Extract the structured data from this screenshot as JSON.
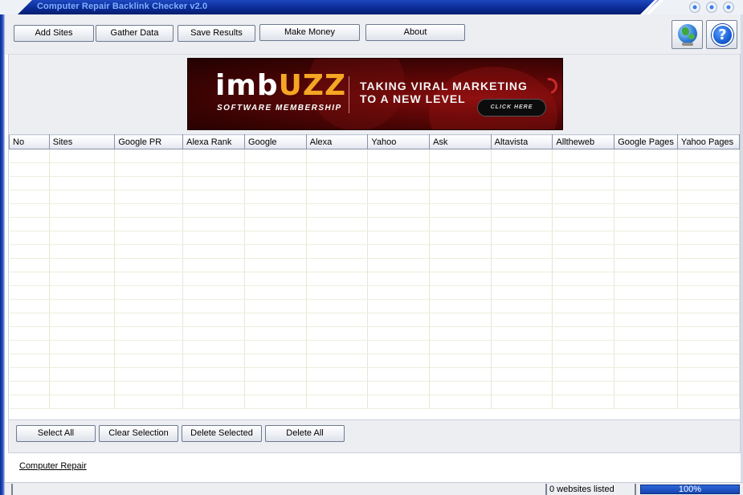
{
  "window": {
    "title": "Computer Repair Backlink Checker v2.0"
  },
  "toolbar": {
    "buttons": [
      {
        "label": "Add Sites"
      },
      {
        "label": "Gather Data"
      },
      {
        "label": "Save Results"
      },
      {
        "label": "Make Money"
      },
      {
        "label": "About"
      }
    ],
    "globe_icon": "globe-icon",
    "help_icon": "help-icon",
    "help_glyph": "?"
  },
  "banner": {
    "logo_part1": "imb",
    "logo_part2": "UZZ",
    "subtitle": "SOFTWARE MEMBERSHIP",
    "tagline1": "TAKING VIRAL MARKETING",
    "tagline2": "TO A NEW LEVEL",
    "cta": "CLICK HERE"
  },
  "table": {
    "columns": [
      "No",
      "Sites",
      "Google PR",
      "Alexa Rank",
      "Google",
      "Alexa",
      "Yahoo",
      "Ask",
      "Altavista",
      "Alltheweb",
      "Google Pages",
      "Yahoo Pages"
    ],
    "rows": []
  },
  "actions": {
    "buttons": [
      {
        "label": "Select All"
      },
      {
        "label": "Clear Selection"
      },
      {
        "label": "Delete Selected"
      },
      {
        "label": "Delete All"
      }
    ]
  },
  "footer": {
    "link": "Computer Repair"
  },
  "status": {
    "websites_listed": "0 websites listed",
    "progress_text": "100%",
    "progress_value": 100
  },
  "colors": {
    "title_bar": "#0b2b96",
    "title_text": "#7fb0ff",
    "progress_fill": "#1544b0",
    "grid_line": "#e3e8d4"
  }
}
